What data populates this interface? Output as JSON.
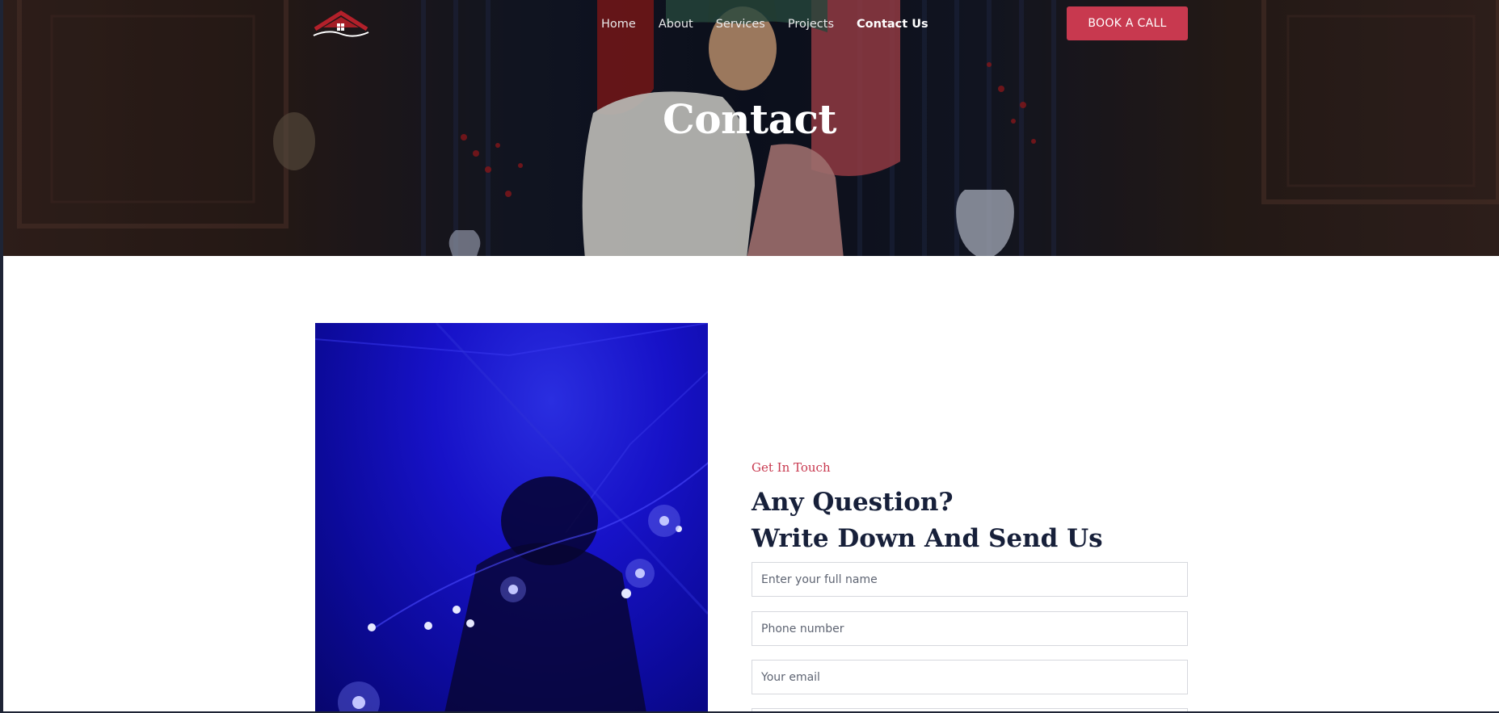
{
  "header": {
    "logo_alt": "house logo",
    "nav": [
      {
        "label": "Home"
      },
      {
        "label": "About"
      },
      {
        "label": "Services"
      },
      {
        "label": "Projects"
      },
      {
        "label": "Contact Us",
        "active": true
      }
    ],
    "cta_label": "BOOK A CALL"
  },
  "hero": {
    "title": "Contact"
  },
  "contact": {
    "kicker": "Get In Touch",
    "heading_line1": "Any Question?",
    "heading_line2": "Write Down And Send Us",
    "fields": {
      "name_placeholder": "Enter your full name",
      "phone_placeholder": "Phone number",
      "email_placeholder": "Your email"
    }
  },
  "colors": {
    "accent": "#c8394f",
    "heading": "#17203a",
    "photo_blue": "#1712c8"
  }
}
